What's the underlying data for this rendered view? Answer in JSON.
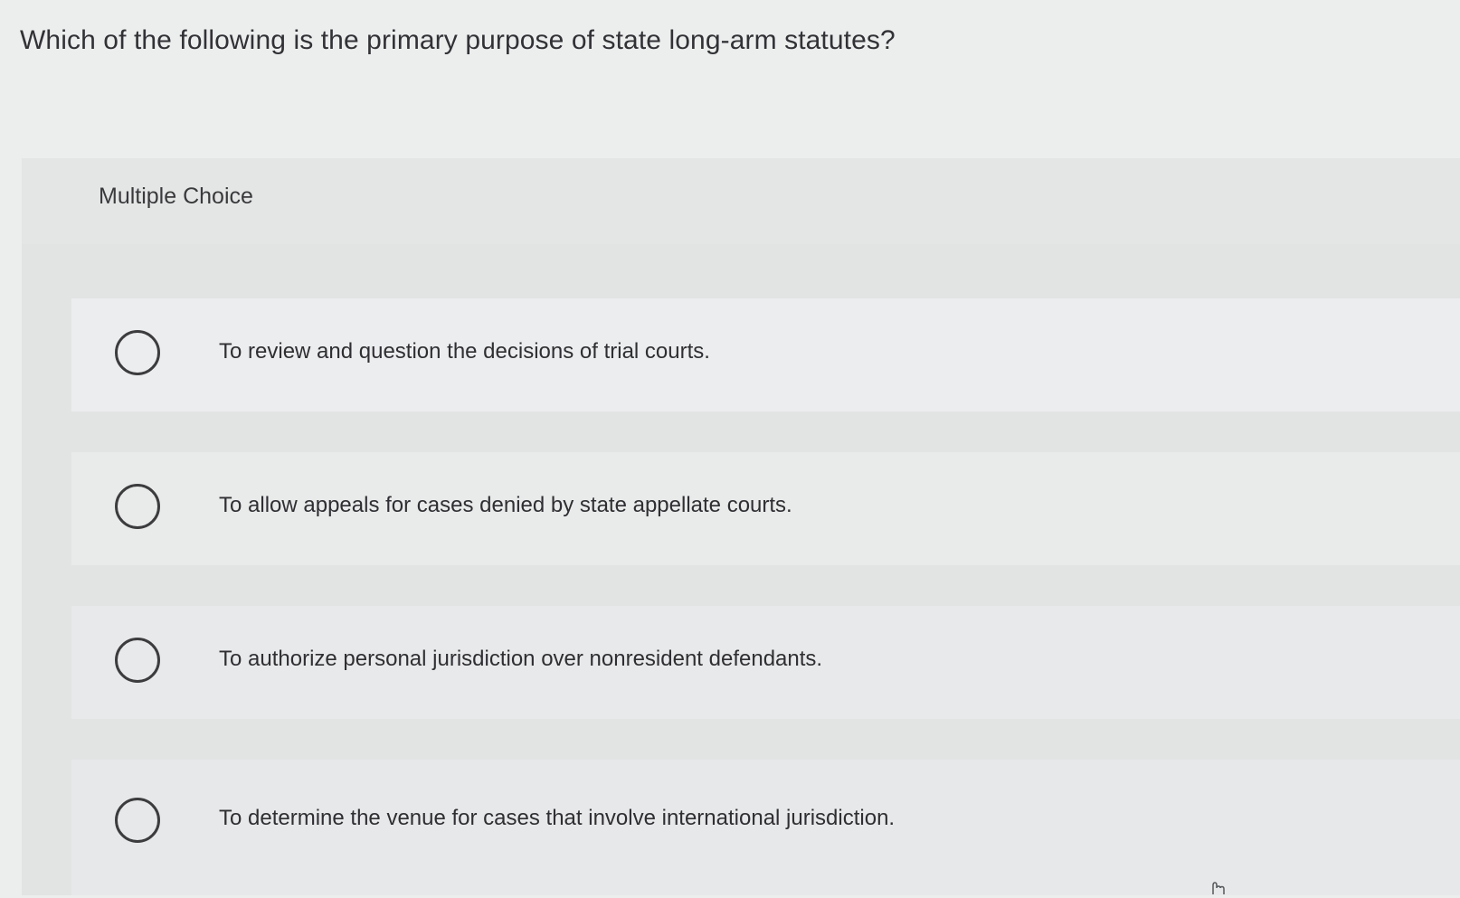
{
  "question": {
    "text": "Which of the following is the primary purpose of state long-arm statutes?"
  },
  "panel": {
    "label": "Multiple Choice"
  },
  "choices": [
    {
      "text": "To review and question the decisions of trial courts.",
      "selected": false
    },
    {
      "text": "To allow appeals for cases denied by state appellate courts.",
      "selected": false
    },
    {
      "text": "To authorize personal jurisdiction over nonresident defendants.",
      "selected": false
    },
    {
      "text": "To determine the venue for cases that involve international jurisdiction.",
      "selected": false
    }
  ],
  "cursor": {
    "icon": "hand-pointer-icon"
  }
}
